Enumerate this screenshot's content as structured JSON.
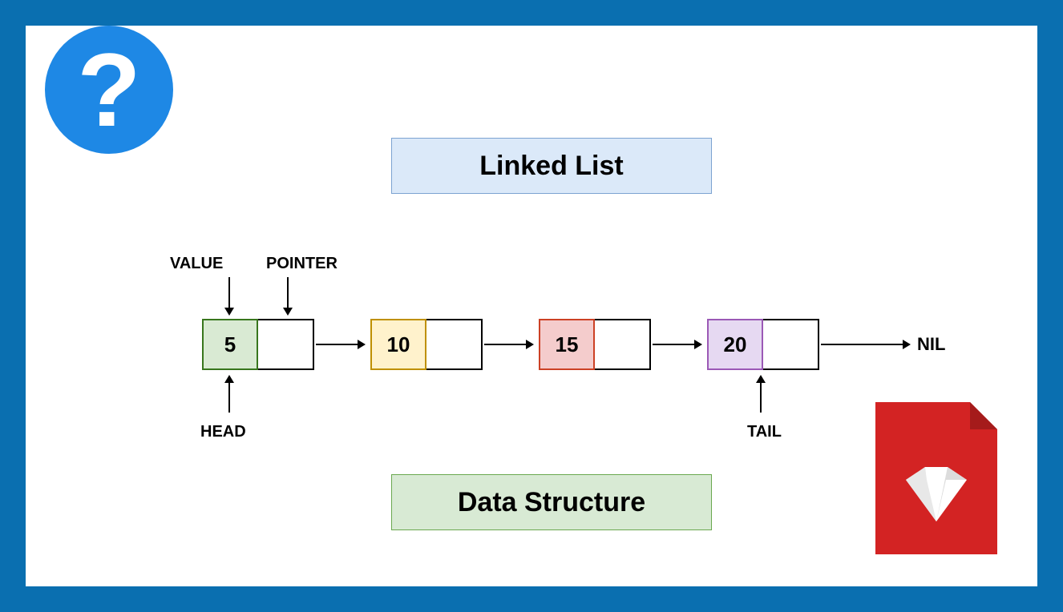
{
  "title": "Linked List",
  "subtitle": "Data Structure",
  "labels": {
    "value": "VALUE",
    "pointer": "POINTER",
    "head": "HEAD",
    "tail": "TAIL",
    "nil": "NIL"
  },
  "nodes": [
    {
      "value": "5",
      "role": "head"
    },
    {
      "value": "10",
      "role": "mid"
    },
    {
      "value": "15",
      "role": "mid"
    },
    {
      "value": "20",
      "role": "tail"
    }
  ],
  "icons": {
    "help": "?",
    "file_type": "ruby"
  }
}
